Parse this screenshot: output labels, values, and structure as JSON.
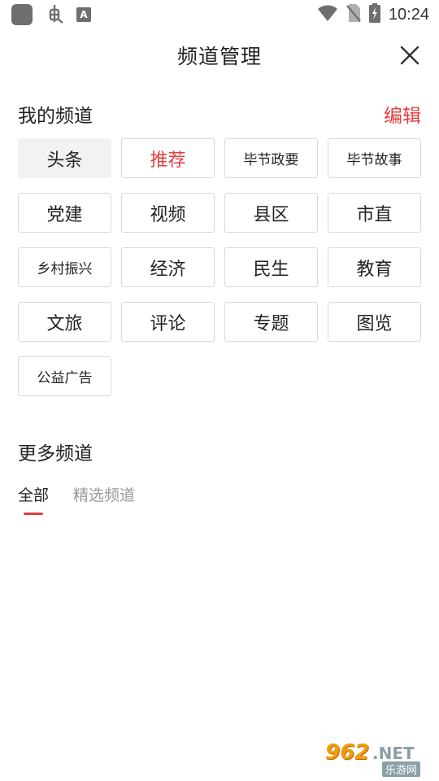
{
  "status_bar": {
    "time": "10:24",
    "icons": [
      "app-square-icon",
      "bug-icon",
      "text-a-icon",
      "wifi-icon",
      "no-sim-icon",
      "battery-charging-icon"
    ]
  },
  "header": {
    "title": "频道管理",
    "close_icon": "close-icon"
  },
  "my_channels": {
    "title": "我的频道",
    "edit_label": "编辑",
    "items": [
      {
        "label": "头条",
        "style": "fixed"
      },
      {
        "label": "推荐",
        "style": "active"
      },
      {
        "label": "毕节政要",
        "style": "small"
      },
      {
        "label": "毕节故事",
        "style": "small"
      },
      {
        "label": "党建",
        "style": "normal"
      },
      {
        "label": "视频",
        "style": "normal"
      },
      {
        "label": "县区",
        "style": "normal"
      },
      {
        "label": "市直",
        "style": "normal"
      },
      {
        "label": "乡村振兴",
        "style": "small"
      },
      {
        "label": "经济",
        "style": "normal"
      },
      {
        "label": "民生",
        "style": "normal"
      },
      {
        "label": "教育",
        "style": "normal"
      },
      {
        "label": "文旅",
        "style": "normal"
      },
      {
        "label": "评论",
        "style": "normal"
      },
      {
        "label": "专题",
        "style": "normal"
      },
      {
        "label": "图览",
        "style": "normal"
      },
      {
        "label": "公益广告",
        "style": "small"
      }
    ]
  },
  "more_channels": {
    "title": "更多频道",
    "tabs": [
      {
        "label": "全部",
        "selected": true
      },
      {
        "label": "精选频道",
        "selected": false
      }
    ]
  },
  "watermark": {
    "number": "962",
    "net": ".NET",
    "subtitle": "乐游网"
  },
  "colors": {
    "accent": "#e0403f",
    "text": "#222222",
    "muted": "#999999",
    "chip_border": "#d9d9d9",
    "fixed_chip_bg": "#f2f2f2"
  }
}
